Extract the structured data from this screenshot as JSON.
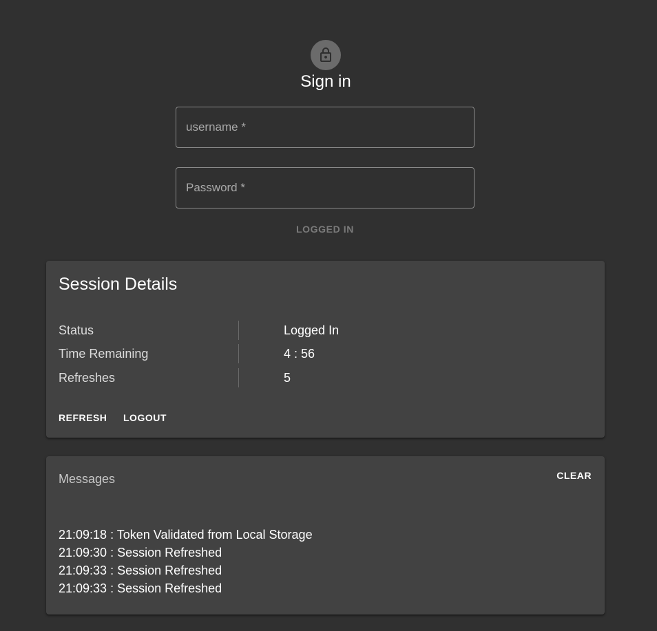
{
  "signin": {
    "icon": "lock-icon",
    "title": "Sign in",
    "username_placeholder": "username *",
    "username_value": "",
    "password_placeholder": "Password *",
    "password_value": "",
    "submit_label": "LOGGED IN"
  },
  "session": {
    "title": "Session Details",
    "rows": [
      {
        "label": "Status",
        "value": "Logged In"
      },
      {
        "label": "Time Remaining",
        "value": "4 : 56"
      },
      {
        "label": "Refreshes",
        "value": "5"
      }
    ],
    "refresh_label": "REFRESH",
    "logout_label": "LOGOUT"
  },
  "messages": {
    "title": "Messages",
    "clear_label": "CLEAR",
    "items": [
      "21:09:18 : Token Validated from Local Storage",
      "21:09:30 : Session Refreshed",
      "21:09:33 : Session Refreshed",
      "21:09:33 : Session Refreshed"
    ]
  },
  "colors": {
    "background": "#303030",
    "card": "#424242",
    "avatar": "#6b6b6b",
    "disabled_text": "#7a7a7a"
  }
}
